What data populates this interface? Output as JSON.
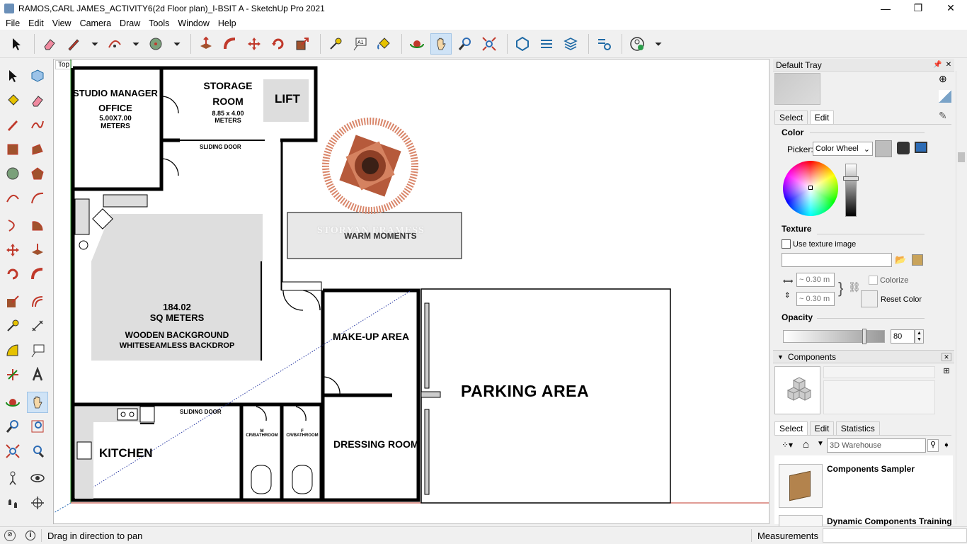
{
  "window": {
    "title": "RAMOS,CARL JAMES_ACTIVITY6(2d Floor plan)_I-BSIT A - SketchUp Pro 2021",
    "min": "—",
    "max": "❐",
    "close": "✕"
  },
  "menu": [
    "File",
    "Edit",
    "View",
    "Camera",
    "Draw",
    "Tools",
    "Window",
    "Help"
  ],
  "viewport": {
    "view_label": "Top"
  },
  "plan": {
    "studio_manager_office": "STUDIO MANAGER",
    "office": "OFFICE",
    "office_size": "5.00X7.00",
    "office_units": "METERS",
    "storage_room": "STORAGE",
    "room": "ROOM",
    "storage_size": "8.85 x 4.00",
    "storage_units": "METERS",
    "lift": "LIFT",
    "sliding_door_top": "SLIDING DOOR",
    "sliding_door_bottom": "SLIDING DOOR",
    "warm_moments": "WARM MOMENTS",
    "watermark": "STORYAN FRAMESS",
    "area": "184.02",
    "area_units": "SQ METERS",
    "wooden_background": "WOODEN BACKGROUND",
    "backdrop": "WHITESEAMLESS BACKDROP",
    "makeup_area": "MAKE-UP AREA",
    "parking_area": "PARKING AREA",
    "kitchen": "KITCHEN",
    "dressing_room": "DRESSING ROOM",
    "cr_m_label": "M",
    "cr_m": "CR/BATHROOM",
    "cr_f_label": "F",
    "cr_f": "CR/BATHROOM"
  },
  "tray": {
    "title": "Default Tray",
    "materials": {
      "tabs": [
        "Select",
        "Edit"
      ],
      "color_section": "Color",
      "picker_label": "Picker:",
      "picker_value": "Color Wheel",
      "texture_section": "Texture",
      "use_texture": "Use texture image",
      "width_value": "~ 0.30 m",
      "height_value": "~ 0.30 m",
      "colorize": "Colorize",
      "reset_color": "Reset Color",
      "opacity_section": "Opacity",
      "opacity_value": "80",
      "opacity_fraction": 0.8
    },
    "components": {
      "title": "Components",
      "tabs": [
        "Select",
        "Edit",
        "Statistics"
      ],
      "search_placeholder": "3D Warehouse",
      "items": [
        "Components Sampler",
        "Dynamic Components Training"
      ]
    }
  },
  "status": {
    "hint": "Drag in direction to pan",
    "measurements_label": "Measurements"
  },
  "colors": {
    "accent": "#3c78b5",
    "wall": "#000000",
    "axis_green": "#1a8a1a",
    "axis_red": "#c0392b",
    "logo": "#c8643c"
  }
}
